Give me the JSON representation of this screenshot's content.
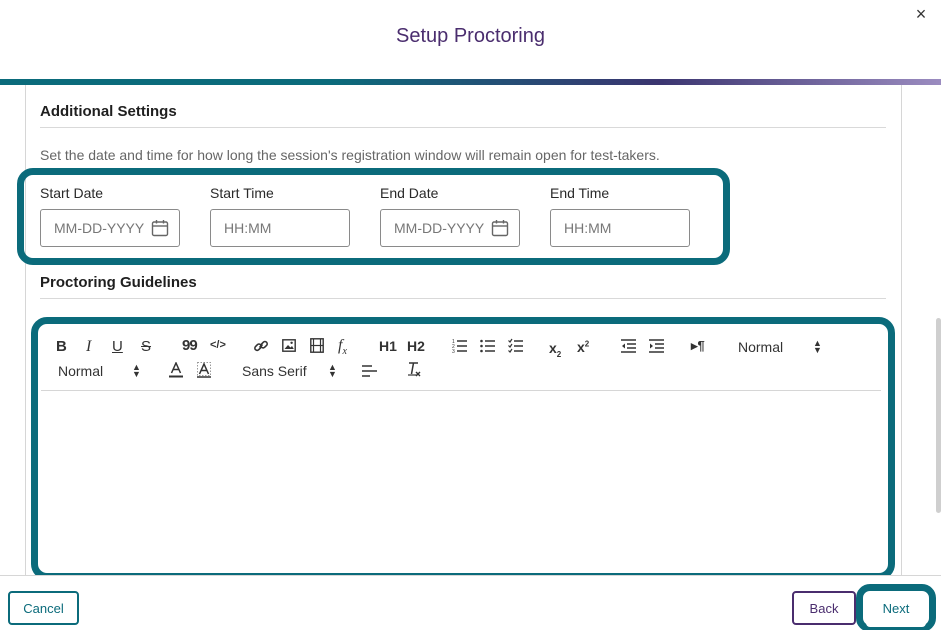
{
  "dialog": {
    "title": "Setup Proctoring",
    "close_glyph": "×"
  },
  "additional_settings": {
    "heading": "Additional Settings",
    "help_text": "Set the date and time for how long the session's registration window will remain open for test-takers.",
    "fields": [
      {
        "label": "Start Date",
        "placeholder": "MM-DD-YYYY",
        "icon": "calendar-icon"
      },
      {
        "label": "Start Time",
        "placeholder": "HH:MM"
      },
      {
        "label": "End Date",
        "placeholder": "MM-DD-YYYY",
        "icon": "calendar-icon"
      },
      {
        "label": "End Time",
        "placeholder": "HH:MM"
      }
    ]
  },
  "guidelines": {
    "heading": "Proctoring Guidelines",
    "toolbar": {
      "bold": "B",
      "italic": "I",
      "underline": "U",
      "strike": "S",
      "quote": "99",
      "code": "</>",
      "h1": "H1",
      "h2": "H2",
      "subscript": "x",
      "subscript_mark": "2",
      "superscript": "x",
      "superscript_mark": "2",
      "direction": "▸¶",
      "header_select": "Normal",
      "size_select": "Normal",
      "font_select": "Sans Serif"
    },
    "editor_content": ""
  },
  "footer": {
    "cancel": "Cancel",
    "back": "Back",
    "next": "Next"
  },
  "colors": {
    "accent": "#0b6b7b",
    "brand_purple": "#4a2d6e"
  }
}
